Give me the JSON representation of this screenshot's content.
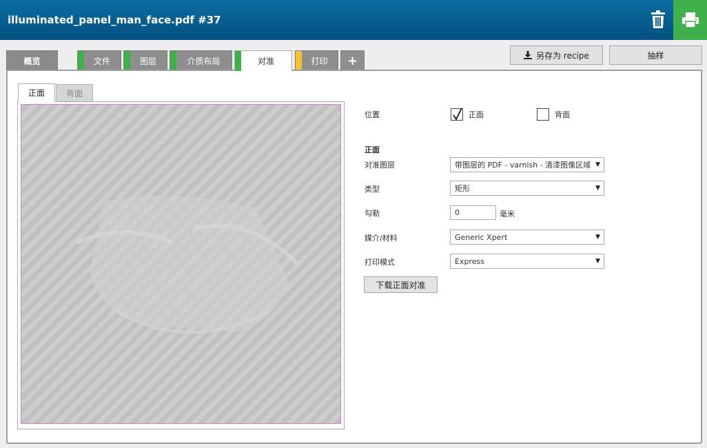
{
  "window": {
    "title": "illuminated_panel_man_face.pdf #37"
  },
  "icons": {
    "trash": "trash-icon",
    "print": "printer-icon",
    "download": "download-icon",
    "plus": "plus-icon",
    "checkmark": "checkmark-icon",
    "dropdown": "chevron-down-icon"
  },
  "colors": {
    "title_bar": "#03507f",
    "print_button": "#3fb04b",
    "stripe_green": "#3fb04b",
    "stripe_yellow": "#f2c230",
    "preview_border": "#d77ad0"
  },
  "tabs": [
    {
      "label": "概览"
    },
    {
      "label": "文件"
    },
    {
      "label": "图层"
    },
    {
      "label": "介质布局"
    },
    {
      "label": "对准"
    },
    {
      "label": "打印"
    },
    {
      "label": "+"
    }
  ],
  "toolbar": {
    "save_recipe": "另存为 recipe",
    "sample": "抽样"
  },
  "side_tabs": {
    "front": "正面",
    "back": "背面"
  },
  "form": {
    "position_label": "位置",
    "front_option": "正面",
    "back_option": "背面",
    "front_checked": true,
    "back_checked": false,
    "section_heading": "正面",
    "registration_layer_label": "对准图层",
    "registration_layer_value": "带图层的 PDF - varnish - 清漆图像区域",
    "type_label": "类型",
    "type_value": "矩形",
    "bleed_label": "勾勒",
    "bleed_value": "0",
    "bleed_unit": "毫米",
    "media_label": "媒介/材料",
    "media_value": "Generic Xpert",
    "print_mode_label": "打印模式",
    "print_mode_value": "Express",
    "download_button": "下载正面对准"
  }
}
